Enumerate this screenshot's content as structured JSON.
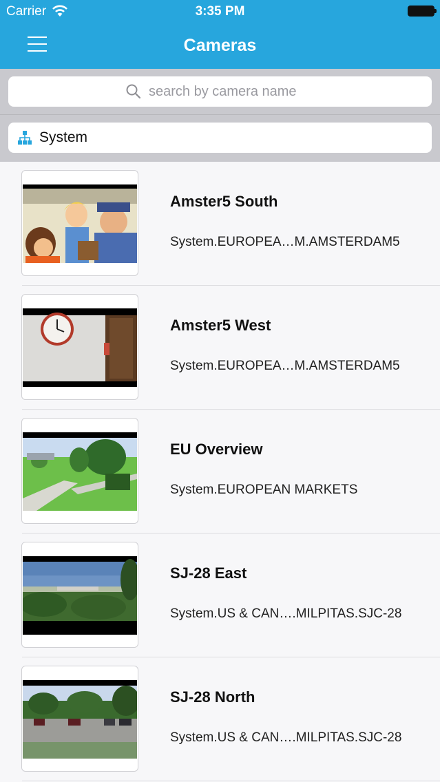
{
  "status_bar": {
    "carrier": "Carrier",
    "time": "3:35 PM"
  },
  "header": {
    "title": "Cameras",
    "menu_icon": "hamburger-menu-icon"
  },
  "search": {
    "placeholder": "search by camera name",
    "value": "",
    "icon": "search-icon"
  },
  "filter": {
    "label": "System",
    "icon": "hierarchy-tree-icon",
    "icon_color": "#27a6dd"
  },
  "colors": {
    "accent": "#27a6dd",
    "band": "#c9c9ce",
    "background": "#f7f7f9"
  },
  "cameras": [
    {
      "name": "Amster5 South",
      "path": "System.EUROPEA…M.AMSTERDAM5",
      "thumbnail": "cartoon-scene"
    },
    {
      "name": "Amster5 West",
      "path": "System.EUROPEA…M.AMSTERDAM5",
      "thumbnail": "office-wall-clock"
    },
    {
      "name": "EU Overview",
      "path": "System.EUROPEAN MARKETS",
      "thumbnail": "campus-lawn"
    },
    {
      "name": "SJ-28 East",
      "path": "System.US & CAN….MILPITAS.SJC-28",
      "thumbnail": "trees-and-sky"
    },
    {
      "name": "SJ-28 North",
      "path": "System.US & CAN….MILPITAS.SJC-28",
      "thumbnail": "parking-lot"
    }
  ]
}
